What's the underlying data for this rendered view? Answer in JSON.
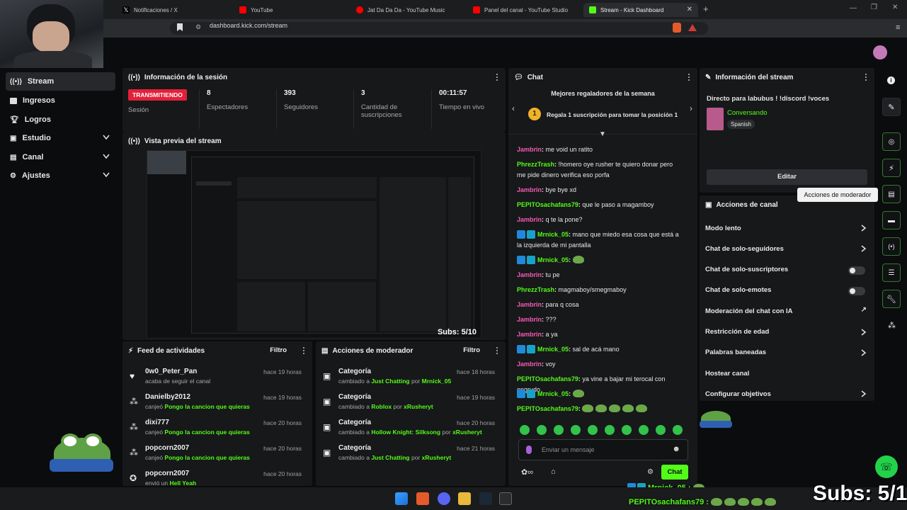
{
  "browser": {
    "tabs": [
      {
        "label": "Notificaciones / X",
        "icon": "x-logo-icon"
      },
      {
        "label": "YouTube",
        "icon": "youtube-icon"
      },
      {
        "label": "Jat Da Da Da - YouTube Music",
        "icon": "youtube-music-icon"
      },
      {
        "label": "Panel del canal - YouTube Studio",
        "icon": "youtube-studio-icon"
      },
      {
        "label": "Stream - Kick Dashboard",
        "icon": "kick-icon"
      }
    ],
    "url": "dashboard.kick.com/stream"
  },
  "sidebar": {
    "items": [
      {
        "label": "Stream",
        "icon": "stream-icon",
        "active": true,
        "expand": false
      },
      {
        "label": "Ingresos",
        "icon": "revenue-icon",
        "active": false,
        "expand": false
      },
      {
        "label": "Logros",
        "icon": "trophy-icon",
        "active": false,
        "expand": false
      },
      {
        "label": "Estudio",
        "icon": "studio-icon",
        "active": false,
        "expand": true
      },
      {
        "label": "Canal",
        "icon": "channel-icon",
        "active": false,
        "expand": true
      },
      {
        "label": "Ajustes",
        "icon": "settings-icon",
        "active": false,
        "expand": true
      }
    ]
  },
  "session": {
    "title": "Información de la sesión",
    "status": "TRANSMITIENDO",
    "status_label": "Sesión",
    "stats": [
      {
        "value": "8",
        "label": "Espectadores"
      },
      {
        "value": "393",
        "label": "Seguidores"
      },
      {
        "value": "3",
        "label": "Cantidad de suscripciones"
      },
      {
        "value": "00:11:57",
        "label": "Tiempo en vivo"
      }
    ]
  },
  "preview": {
    "title": "Vista previa del stream",
    "overlay": "Subs: 5/10"
  },
  "feed": {
    "title": "Feed de actividades",
    "filter": "Filtro",
    "items": [
      {
        "name": "0w0_Peter_Pan",
        "time": "hace 19 horas",
        "pre": "acaba de seguir el canal",
        "hl": "",
        "post": "",
        "icon": "heart-icon"
      },
      {
        "name": "Danielby2012",
        "time": "hace 19 horas",
        "pre": "canjeó ",
        "hl": "Pongo la cancion que quieras",
        "post": "",
        "icon": "redeem-icon"
      },
      {
        "name": "dixi777",
        "time": "hace 20 horas",
        "pre": "canjeó ",
        "hl": "Pongo la cancion que quieras",
        "post": "",
        "icon": "redeem-icon"
      },
      {
        "name": "popcorn2007",
        "time": "hace 20 horas",
        "pre": "canjeó ",
        "hl": "Pongo la cancion que quieras",
        "post": "",
        "icon": "redeem-icon"
      },
      {
        "name": "popcorn2007",
        "time": "hace 20 horas",
        "pre": "envió un ",
        "hl": "Hell Yeah",
        "post": "",
        "icon": "kick-coin-icon"
      }
    ]
  },
  "modactions": {
    "title": "Acciones de moderador",
    "filter": "Filtro",
    "items": [
      {
        "name": "Categoría",
        "time": "hace 18 horas",
        "pre": "cambiado a ",
        "hl": "Just Chatting",
        "mid": " por ",
        "by": "Mrnick_05"
      },
      {
        "name": "Categoría",
        "time": "hace 19 horas",
        "pre": "cambiado a ",
        "hl": "Roblox",
        "mid": " por ",
        "by": "xRusheryt"
      },
      {
        "name": "Categoría",
        "time": "hace 20 horas",
        "pre": "cambiado a ",
        "hl": "Hollow Knight: Silksong",
        "mid": " por ",
        "by": "xRusheryt"
      },
      {
        "name": "Categoría",
        "time": "hace 21 horas",
        "pre": "cambiado a ",
        "hl": "Just Chatting",
        "mid": " por ",
        "by": "xRusheryt"
      }
    ]
  },
  "chat": {
    "title": "Chat",
    "gifters_title": "Mejores regaladores de la semana",
    "gifters_rank": "1",
    "gifters_text": "Regala 1 suscripción para tomar la posición 1",
    "messages": [
      {
        "user": "Jambrin",
        "color": "#f45bb4",
        "text": "me void un ratito",
        "badges": false,
        "emotes": 0
      },
      {
        "user": "PhrezzTrash",
        "color": "#53fc18",
        "text": "!homero oye rusher te quiero donar pero me pide dinero verifica eso porfa",
        "badges": false,
        "emotes": 0
      },
      {
        "user": "Jambrin",
        "color": "#f45bb4",
        "text": "bye bye xd",
        "badges": false,
        "emotes": 0
      },
      {
        "user": "PEPITOsachafans79",
        "color": "#53fc18",
        "text": "que le paso a magamboy",
        "badges": false,
        "emotes": 0
      },
      {
        "user": "Jambrin",
        "color": "#f45bb4",
        "text": "q te la pone?",
        "badges": false,
        "emotes": 0
      },
      {
        "user": "Mrnick_05",
        "color": "#53fc18",
        "text": "mano que miedo esa cosa que está a la izquierda de mi pantalla",
        "badges": true,
        "emotes": 0
      },
      {
        "user": "Mrnick_05",
        "color": "#53fc18",
        "text": "",
        "badges": true,
        "emotes": 1
      },
      {
        "user": "Jambrin",
        "color": "#f45bb4",
        "text": "tu pe",
        "badges": false,
        "emotes": 0
      },
      {
        "user": "PhrezzTrash",
        "color": "#53fc18",
        "text": "magmaboy/smegmaboy",
        "badges": false,
        "emotes": 0
      },
      {
        "user": "Jambrin",
        "color": "#f45bb4",
        "text": "para q cosa",
        "badges": false,
        "emotes": 0
      },
      {
        "user": "Jambrin",
        "color": "#f45bb4",
        "text": "???",
        "badges": false,
        "emotes": 0
      },
      {
        "user": "Jambrin",
        "color": "#f45bb4",
        "text": "a ya",
        "badges": false,
        "emotes": 0
      },
      {
        "user": "Mrnick_05",
        "color": "#53fc18",
        "text": "sal de acá mano",
        "badges": true,
        "emotes": 0
      },
      {
        "user": "Jambrin",
        "color": "#f45bb4",
        "text": "voy",
        "badges": false,
        "emotes": 0
      },
      {
        "user": "PEPITOsachafans79",
        "color": "#53fc18",
        "text": "ya vine a bajar mi terocal con engrudo",
        "badges": false,
        "emotes": 0
      },
      {
        "user": "Mrnick_05",
        "color": "#53fc18",
        "text": "",
        "badges": true,
        "emotes": 1
      },
      {
        "user": "PEPITOsachafans79",
        "color": "#53fc18",
        "text": "",
        "badges": false,
        "emotes": 5
      }
    ],
    "input_placeholder": "Enviar un mensaje",
    "send_label": "Chat"
  },
  "streaminfo": {
    "title": "Información del stream",
    "stream_title": "Directo para labubus ! !discord !voces",
    "category": "Conversando",
    "language": "Spanish",
    "edit_label": "Editar"
  },
  "channel_actions": {
    "title": "Acciones de canal",
    "tooltip": "Acciones de moderador",
    "items": [
      {
        "label": "Modo lento",
        "control": "chevron"
      },
      {
        "label": "Chat de solo-seguidores",
        "control": "chevron"
      },
      {
        "label": "Chat de solo-suscriptores",
        "control": "toggle"
      },
      {
        "label": "Chat de solo-emotes",
        "control": "toggle"
      },
      {
        "label": "Moderación del chat con IA",
        "control": "external"
      },
      {
        "label": "Restricción de edad",
        "control": "chevron"
      },
      {
        "label": "Palabras baneadas",
        "control": "chevron"
      },
      {
        "label": "Hostear canal",
        "control": "none"
      },
      {
        "label": "Configurar objetivos",
        "control": "chevron"
      }
    ]
  },
  "overlay": {
    "subs": "Subs: 5/10",
    "bottom_chat": [
      {
        "user": "Mrnick_05 :"
      },
      {
        "user": "PEPITOsachafans79 :"
      }
    ]
  },
  "colors": {
    "accent": "#53fc18",
    "live": "#e3203a",
    "panel": "#17181a",
    "bg": "#0b0c0d"
  }
}
